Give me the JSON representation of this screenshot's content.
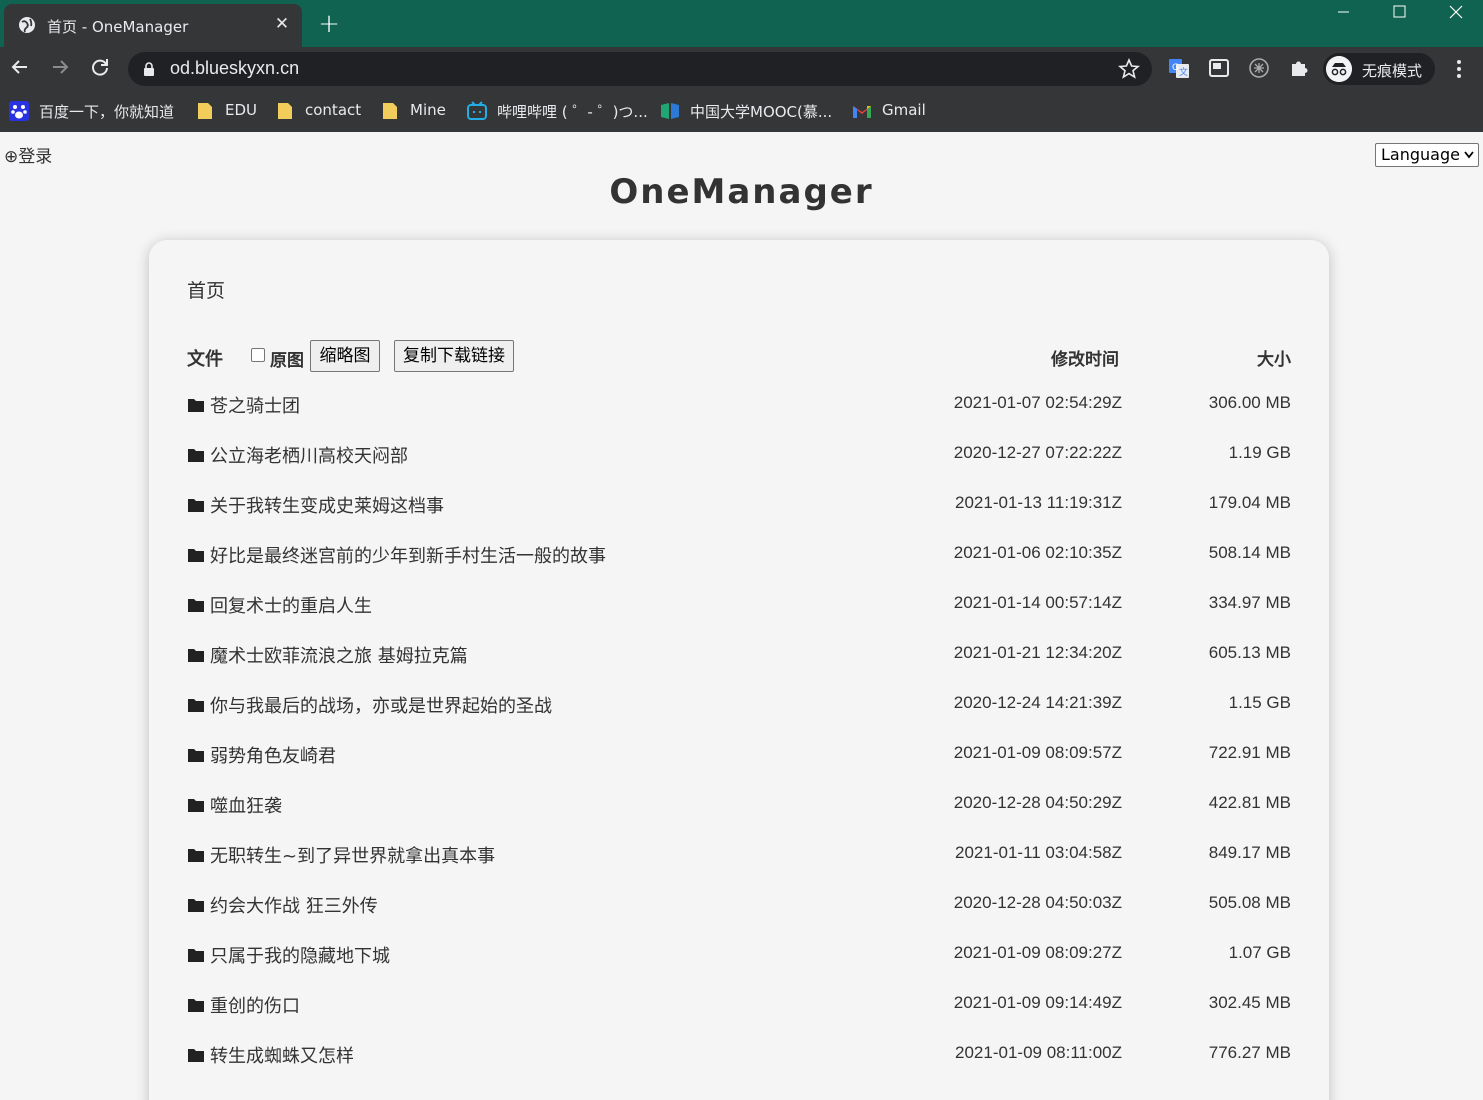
{
  "browser": {
    "tab_title": "首页 - OneManager",
    "url": "od.blueskyxn.cn",
    "incognito_label": "无痕模式",
    "bookmarks": [
      {
        "label": "百度一下，你就知道",
        "icon": "baidu-icon"
      },
      {
        "label": "EDU",
        "icon": "folder-icon"
      },
      {
        "label": "contact",
        "icon": "folder-icon"
      },
      {
        "label": "Mine",
        "icon": "folder-icon"
      },
      {
        "label": "哔哩哔哩 ( ゜- ゜)つ...",
        "icon": "bilibili-icon"
      },
      {
        "label": "中国大学MOOC(慕...",
        "icon": "mooc-icon"
      },
      {
        "label": "Gmail",
        "icon": "gmail-icon"
      }
    ],
    "theme_color": "#0f6350"
  },
  "page": {
    "login_label": "⊕登录",
    "language_select": "Language",
    "site_title": "OneManager",
    "breadcrumb": "首页",
    "header": {
      "file": "文件",
      "original_label": "原图",
      "thumbnail_button": "缩略图",
      "copy_links_button": "复制下载链接",
      "modified": "修改时间",
      "size": "大小"
    },
    "files": [
      {
        "name": "苍之骑士团",
        "modified": "2021-01-07 02:54:29Z",
        "size": "306.00 MB"
      },
      {
        "name": "公立海老栖川高校天闷部",
        "modified": "2020-12-27 07:22:22Z",
        "size": "1.19 GB"
      },
      {
        "name": "关于我转生变成史莱姆这档事",
        "modified": "2021-01-13 11:19:31Z",
        "size": "179.04 MB"
      },
      {
        "name": "好比是最终迷宫前的少年到新手村生活一般的故事",
        "modified": "2021-01-06 02:10:35Z",
        "size": "508.14 MB"
      },
      {
        "name": "回复术士的重启人生",
        "modified": "2021-01-14 00:57:14Z",
        "size": "334.97 MB"
      },
      {
        "name": "魔术士欧菲流浪之旅 基姆拉克篇",
        "modified": "2021-01-21 12:34:20Z",
        "size": "605.13 MB"
      },
      {
        "name": "你与我最后的战场，亦或是世界起始的圣战",
        "modified": "2020-12-24 14:21:39Z",
        "size": "1.15 GB"
      },
      {
        "name": "弱势角色友崎君",
        "modified": "2021-01-09 08:09:57Z",
        "size": "722.91 MB"
      },
      {
        "name": "噬血狂袭",
        "modified": "2020-12-28 04:50:29Z",
        "size": "422.81 MB"
      },
      {
        "name": "无职转生~到了异世界就拿出真本事",
        "modified": "2021-01-11 03:04:58Z",
        "size": "849.17 MB"
      },
      {
        "name": "约会大作战 狂三外传",
        "modified": "2020-12-28 04:50:03Z",
        "size": "505.08 MB"
      },
      {
        "name": "只属于我的隐藏地下城",
        "modified": "2021-01-09 08:09:27Z",
        "size": "1.07 GB"
      },
      {
        "name": "重创的伤口",
        "modified": "2021-01-09 09:14:49Z",
        "size": "302.45 MB"
      },
      {
        "name": "转生成蜘蛛又怎样",
        "modified": "2021-01-09 08:11:00Z",
        "size": "776.27 MB"
      }
    ]
  }
}
